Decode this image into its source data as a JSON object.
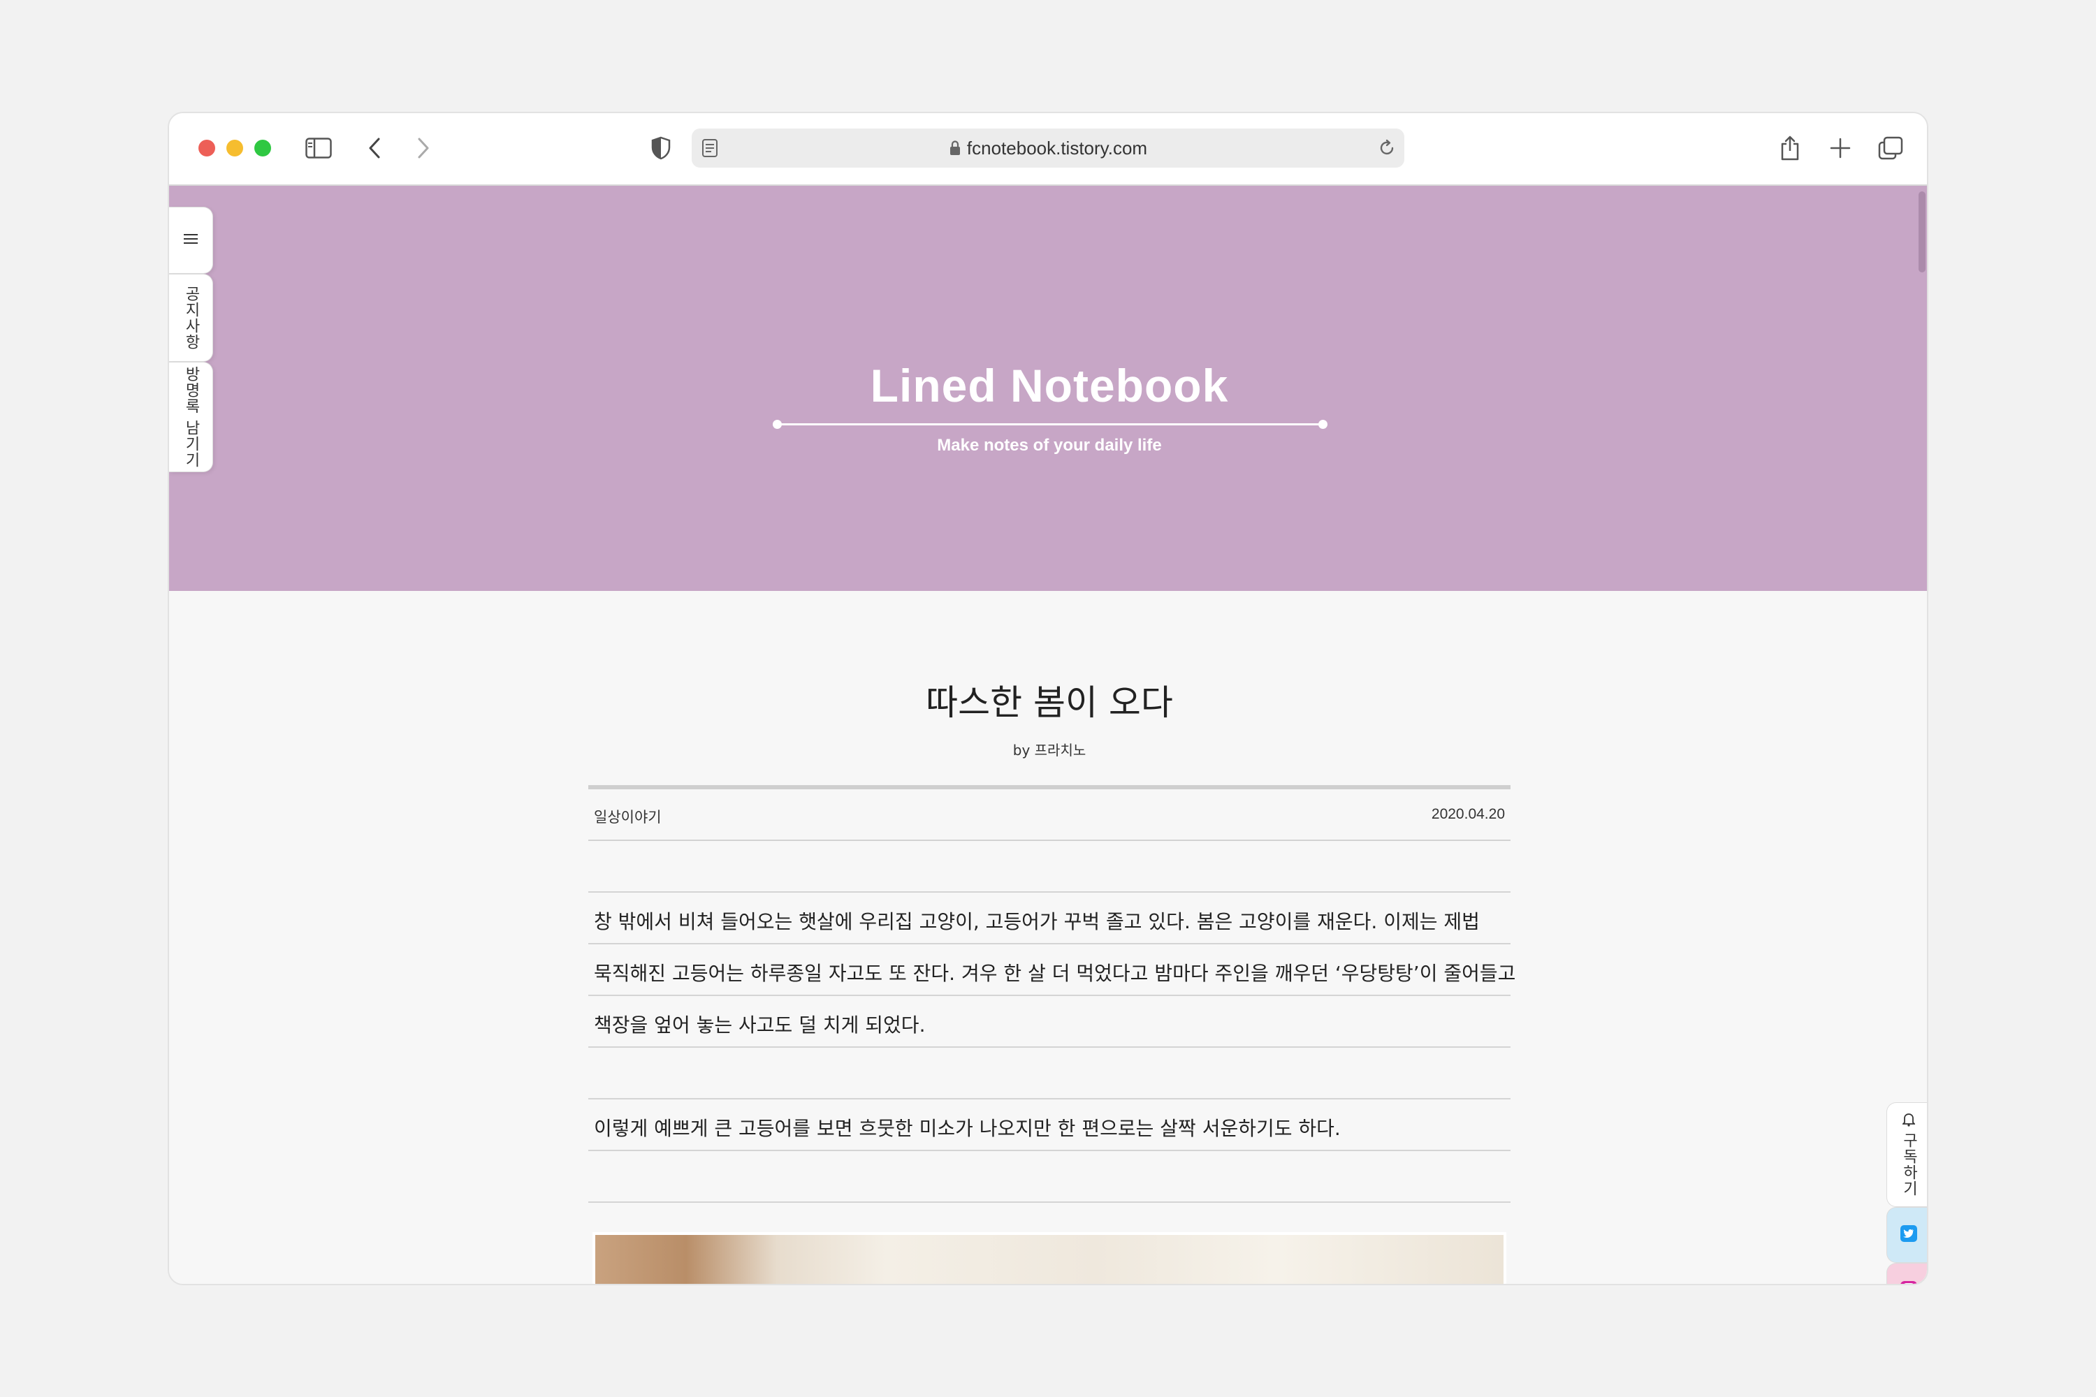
{
  "browser": {
    "url": "fcnotebook.tistory.com",
    "traffic_lights": [
      "#ed5f57",
      "#f6bd2f",
      "#2fc842"
    ]
  },
  "blog": {
    "title": "Lined Notebook",
    "subtitle": "Make notes of your daily life",
    "accent_color": "#c7a6c6"
  },
  "side_menu": {
    "notice_label": "공지사항",
    "guestbook_label": "방명록 남기기"
  },
  "post": {
    "title": "따스한 봄이 오다",
    "byline": "by 프라치노",
    "category": "일상이야기",
    "date": "2020.04.20",
    "paragraph1": [
      "창 밖에서 비쳐 들어오는 햇살에 우리집 고양이, 고등어가 꾸벅 졸고 있다. 봄은 고양이를 재운다. 이제는 제법",
      "묵직해진 고등어는 하루종일 자고도 또 잔다. 겨우 한 살 더 먹었다고 밤마다 주인을 깨우던 ‘우당탕탕’이 줄어들고",
      "책장을 엎어 놓는 사고도 덜 치게 되었다."
    ],
    "paragraph2": [
      "이렇게 예쁘게 큰 고등어를 보면 흐뭇한 미소가 나오지만 한 편으로는 살짝 서운하기도 하다."
    ]
  },
  "float_menu": {
    "subscribe_label": "구독하기",
    "twitter_color": "#cfe9f7",
    "instagram_color": "#f7cfdf"
  }
}
